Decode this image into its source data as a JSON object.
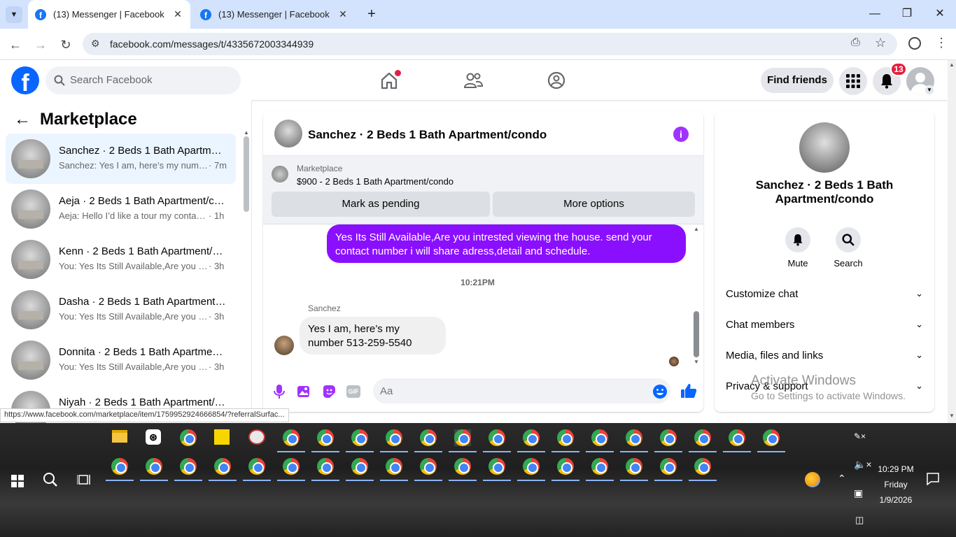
{
  "browser": {
    "tabs": [
      {
        "title": "(13) Messenger | Facebook",
        "active": true
      },
      {
        "title": "(13) Messenger | Facebook",
        "active": false
      }
    ],
    "url": "facebook.com/messages/t/4335672003344939",
    "status_url": "https://www.facebook.com/marketplace/item/1759952924666854/?referralSurfac..."
  },
  "fb_header": {
    "search_placeholder": "Search Facebook",
    "find_friends_label": "Find friends",
    "notifications_count": "13"
  },
  "left_panel": {
    "title": "Marketplace",
    "conversations": [
      {
        "name": "Sanchez · 2 Beds 1 Bath Apartment/condo",
        "preview": "Sanchez: Yes I am, here’s my number 513-259-5540",
        "time": "· 7m",
        "selected": true
      },
      {
        "name": "Aeja · 2 Beds 1 Bath Apartment/condo",
        "preview": "Aeja: Hello I’d like a tour my contact info",
        "time": "· 1h"
      },
      {
        "name": "Kenn · 2 Beds 1 Bath Apartment/condo",
        "preview": "You: Yes Its Still Available,Are you intrested",
        "time": "· 3h"
      },
      {
        "name": "Dasha · 2 Beds 1 Bath Apartment/condo",
        "preview": "You: Yes Its Still Available,Are you intrested",
        "time": "· 3h"
      },
      {
        "name": "Donnita · 2 Beds 1 Bath Apartment/condo",
        "preview": "You: Yes Its Still Available,Are you intrested",
        "time": "· 3h"
      },
      {
        "name": "Niyah · 2 Beds 1 Bath Apartment/condo",
        "preview": "",
        "time": ""
      }
    ]
  },
  "chat": {
    "title": "Sanchez · 2 Beds 1 Bath Apartment/condo",
    "marketplace_label": "Marketplace",
    "listing": "$900 - 2 Beds 1 Bath Apartment/condo",
    "mark_pending_label": "Mark as pending",
    "more_options_label": "More options",
    "outgoing_message": "Yes Its Still Available,Are you intrested viewing the house. send your contact number i will share adress,detail and schedule.",
    "timestamp": "10:21PM",
    "sender_name": "Sanchez",
    "incoming_message": "Yes I am, here’s my number 513-259-5540",
    "input_placeholder": "Aa"
  },
  "right_panel": {
    "name": "Sanchez · 2 Beds 1 Bath Apartment/condo",
    "mute_label": "Mute",
    "search_label": "Search",
    "sections": [
      "Customize chat",
      "Chat members",
      "Media, files and links",
      "Privacy & support"
    ]
  },
  "watermark": {
    "line1": "Activate Windows",
    "line2": "Go to Settings to activate Windows."
  },
  "taskbar": {
    "time": "10:29 PM",
    "day": "Friday",
    "date": "1/9/2026"
  },
  "colors": {
    "fb_blue": "#0866ff",
    "messenger_purple": "#8a0fff",
    "notif_red": "#e41e3f"
  }
}
